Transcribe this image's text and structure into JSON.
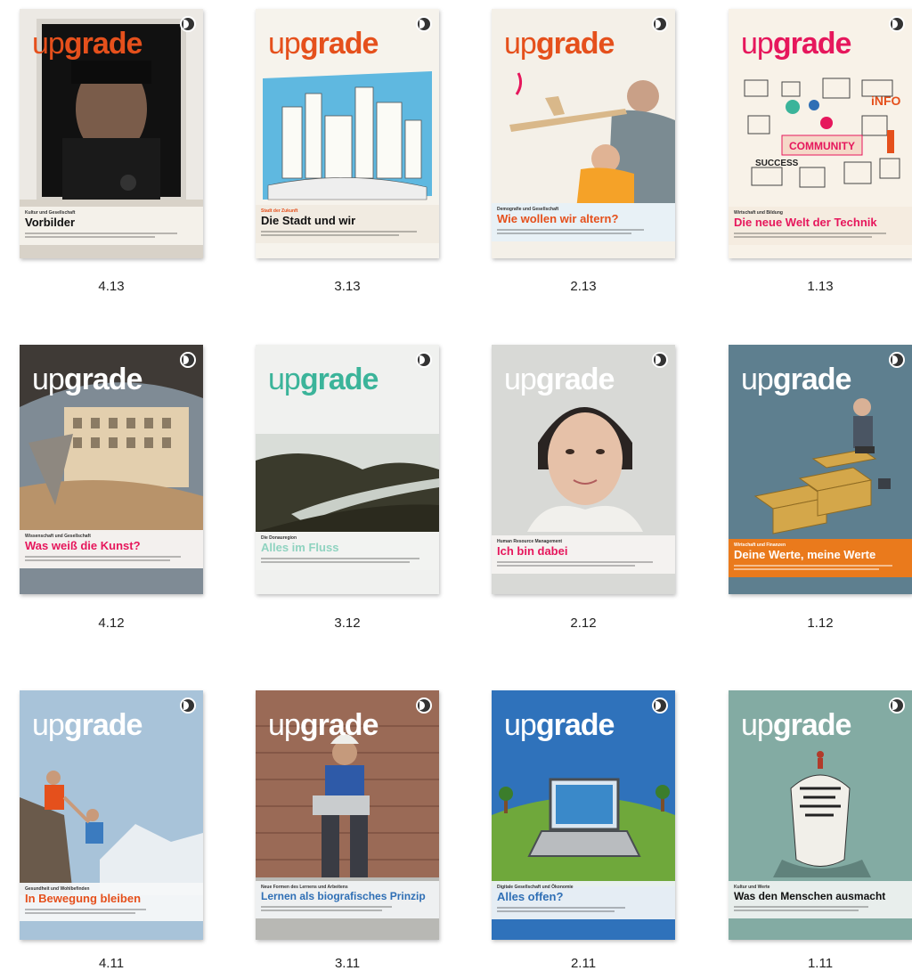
{
  "issues": [
    {
      "caption": "4.13",
      "section": "Kultur und Gesellschaft",
      "headline": "Vorbilder"
    },
    {
      "caption": "3.13",
      "section": "Stadt der Zukunft",
      "headline": "Die Stadt und wir"
    },
    {
      "caption": "2.13",
      "section": "Demografie und Gesellschaft",
      "headline": "Wie wollen wir altern?"
    },
    {
      "caption": "1.13",
      "section": "Wirtschaft und Bildung",
      "headline": "Die neue Welt der Technik"
    },
    {
      "caption": "4.12",
      "section": "Wissenschaft und Gesellschaft",
      "headline": "Was weiß die Kunst?"
    },
    {
      "caption": "3.12",
      "section": "Die Donauregion",
      "headline": "Alles im Fluss"
    },
    {
      "caption": "2.12",
      "section": "Human Resource Management",
      "headline": "Ich bin dabei"
    },
    {
      "caption": "1.12",
      "section": "Wirtschaft und Finanzen",
      "headline": "Deine Werte, meine Werte"
    },
    {
      "caption": "4.11",
      "section": "Gesundheit und Wohlbefinden",
      "headline": "In Bewegung bleiben"
    },
    {
      "caption": "3.11",
      "section": "Neue Formen des Lernens und Arbeitens",
      "headline": "Lernen als biografisches Prinzip"
    },
    {
      "caption": "2.11",
      "section": "Digitale Gesellschaft und Ökonomie",
      "headline": "Alles offen?"
    },
    {
      "caption": "1.11",
      "section": "Kultur und Werte",
      "headline": "Was den Menschen ausmacht"
    }
  ],
  "brand": {
    "up": "up",
    "grade": "grade"
  },
  "colors": {
    "orange": "#e5501c",
    "pink": "#e6175c",
    "teal": "#3bb49a",
    "blue": "#2f6fb5",
    "band_orange": "#ea7a1c"
  }
}
